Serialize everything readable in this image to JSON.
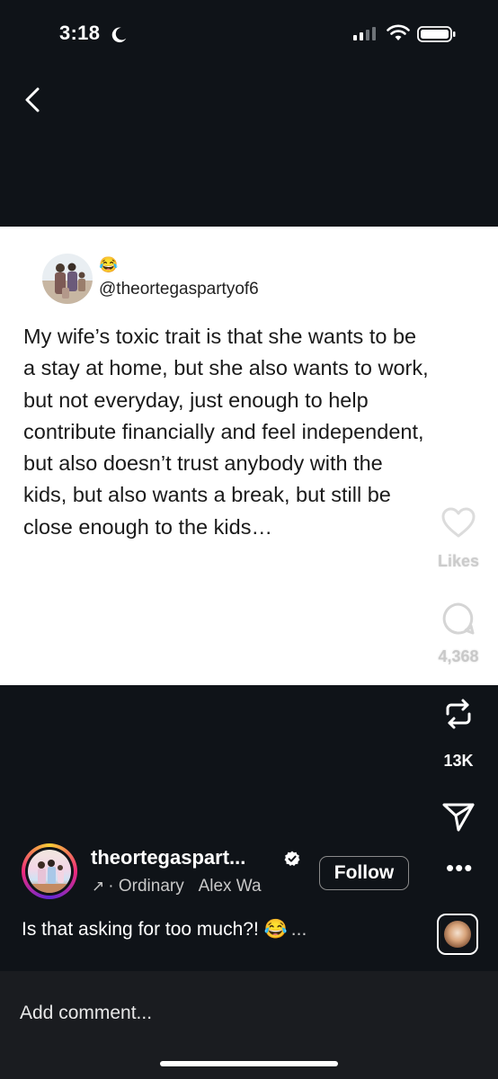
{
  "status_bar": {
    "time": "3:18",
    "icons": [
      "moon-icon",
      "cellular-signal-icon",
      "wifi-icon",
      "battery-icon"
    ]
  },
  "nav": {
    "back_icon": "chevron-left-icon"
  },
  "post_image": {
    "emoji": "😂",
    "handle": "@theortegaspartyof6",
    "text": "My wife’s toxic trait is that she wants to be\na stay at home, but she also wants to work,\nbut not everyday, just enough to help\ncontribute financially and feel independent,\nbut also doesn’t trust anybody with the\nkids, but also wants a break, but still be\nclose enough to the kids…"
  },
  "actions": {
    "likes_label": "Likes",
    "comments_count": "4,368",
    "reposts_count": "13K",
    "icons": [
      "heart-icon",
      "comment-icon",
      "repost-icon",
      "send-icon"
    ]
  },
  "author": {
    "name": "theortegaspart...",
    "music": "Ordinary",
    "music_artist": "Alex Wa",
    "follow_label": "Follow",
    "more_label": "•••"
  },
  "caption": {
    "text": "Is that asking for too much?! 😂",
    "more": "..."
  },
  "comment": {
    "placeholder": "Add comment..."
  },
  "colors": {
    "background": "#0f1318",
    "card": "#ffffff",
    "story_ring": [
      "#f9ce34",
      "#ee2a7b",
      "#6228d7"
    ]
  }
}
